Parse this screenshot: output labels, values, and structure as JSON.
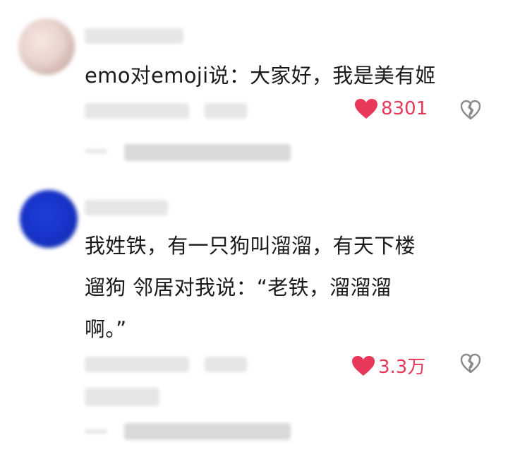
{
  "comments": [
    {
      "text": "emo对emoji说：大家好，我是美有姬",
      "likes": "8301",
      "icons": {
        "like": "heart-icon",
        "dislike": "broken-heart-icon"
      },
      "colors": {
        "like": "#e8385a",
        "dislike": "#8a8a8a"
      }
    },
    {
      "text_lines": [
        "我姓铁，有一只狗叫溜溜，有天下楼",
        "遛狗 邻居对我说：“老铁，溜溜溜",
        "啊。”"
      ],
      "likes": "3.3万",
      "icons": {
        "like": "heart-icon",
        "dislike": "broken-heart-icon"
      },
      "colors": {
        "like": "#e8385a",
        "dislike": "#8a8a8a"
      }
    }
  ]
}
